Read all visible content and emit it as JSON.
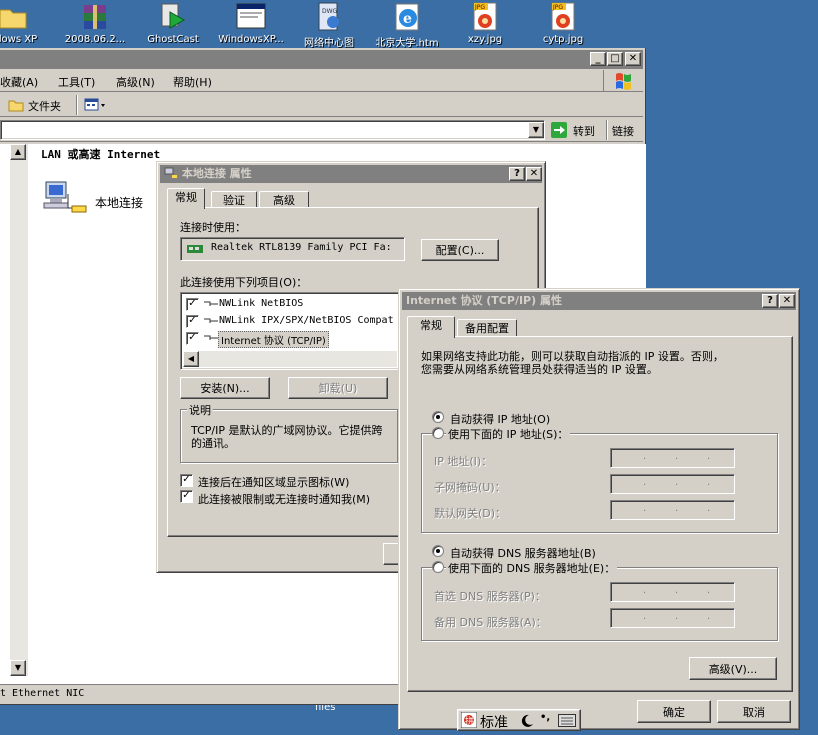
{
  "desktop": {
    "icons": [
      {
        "label": "ndows XP",
        "icon": "folder-icon"
      },
      {
        "label": "2008.06.2...",
        "icon": "winrar-archive-icon"
      },
      {
        "label": "GhostCast",
        "icon": "ghostcast-icon"
      },
      {
        "label": "WindowsXP...",
        "icon": "window-file-icon"
      },
      {
        "label": "网络中心图",
        "icon": "visio-file-icon"
      },
      {
        "label": "北京大学.htm",
        "icon": "ie-html-icon"
      },
      {
        "label": "xzy.jpg",
        "icon": "jpg-file-icon"
      },
      {
        "label": "cytp.jpg",
        "icon": "jpg-file-icon"
      }
    ],
    "files_label": "files"
  },
  "explorer": {
    "menu": [
      "收藏(A)",
      "工具(T)",
      "高级(N)",
      "帮助(H)"
    ],
    "folders_button": "文件夹",
    "go_button": "转到",
    "links_button": "链接",
    "section_header": "LAN 或高速 Internet",
    "connection_label": "本地连接",
    "status_text": "t Ethernet NIC"
  },
  "props_dialog": {
    "title": "本地连接 属性",
    "tabs": [
      "常规",
      "验证",
      "高级"
    ],
    "connect_using_label": "连接时使用：",
    "adapter": "Realtek RTL8139 Family PCI Fa:",
    "configure_button": "配置(C)...",
    "items_label": "此连接使用下列项目(O)：",
    "items": [
      "NWLink NetBIOS",
      "NWLink IPX/SPX/NetBIOS Compat",
      "Internet 协议 (TCP/IP)"
    ],
    "install_button": "安装(N)...",
    "uninstall_button": "卸载(U)",
    "description_title": "说明",
    "description_line1": "TCP/IP 是默认的广域网协议。它提供跨",
    "description_line2": "的通讯。",
    "show_icon_label": "连接后在通知区域显示图标(W)",
    "notify_label": "此连接被限制或无连接时通知我(M)"
  },
  "tcpip_dialog": {
    "title": "Internet 协议 (TCP/IP) 属性",
    "tabs": [
      "常规",
      "备用配置"
    ],
    "intro_line1": "如果网络支持此功能，则可以获取自动指派的 IP 设置。否则，",
    "intro_line2": "您需要从网络系统管理员处获得适当的 IP 设置。",
    "auto_ip": "自动获得 IP 地址(O)",
    "manual_ip": "使用下面的 IP 地址(S)：",
    "ip_address": "IP 地址(I)：",
    "subnet_mask": "子网掩码(U)：",
    "gateway": "默认网关(D)：",
    "auto_dns": "自动获得 DNS 服务器地址(B)",
    "manual_dns": "使用下面的 DNS 服务器地址(E)：",
    "preferred_dns": "首选 DNS 服务器(P)：",
    "alternate_dns": "备用 DNS 服务器(A)：",
    "advanced_button": "高级(V)...",
    "ok_button": "确定",
    "cancel_button": "取消"
  },
  "ime_bar": {
    "mode_label": "标准"
  }
}
